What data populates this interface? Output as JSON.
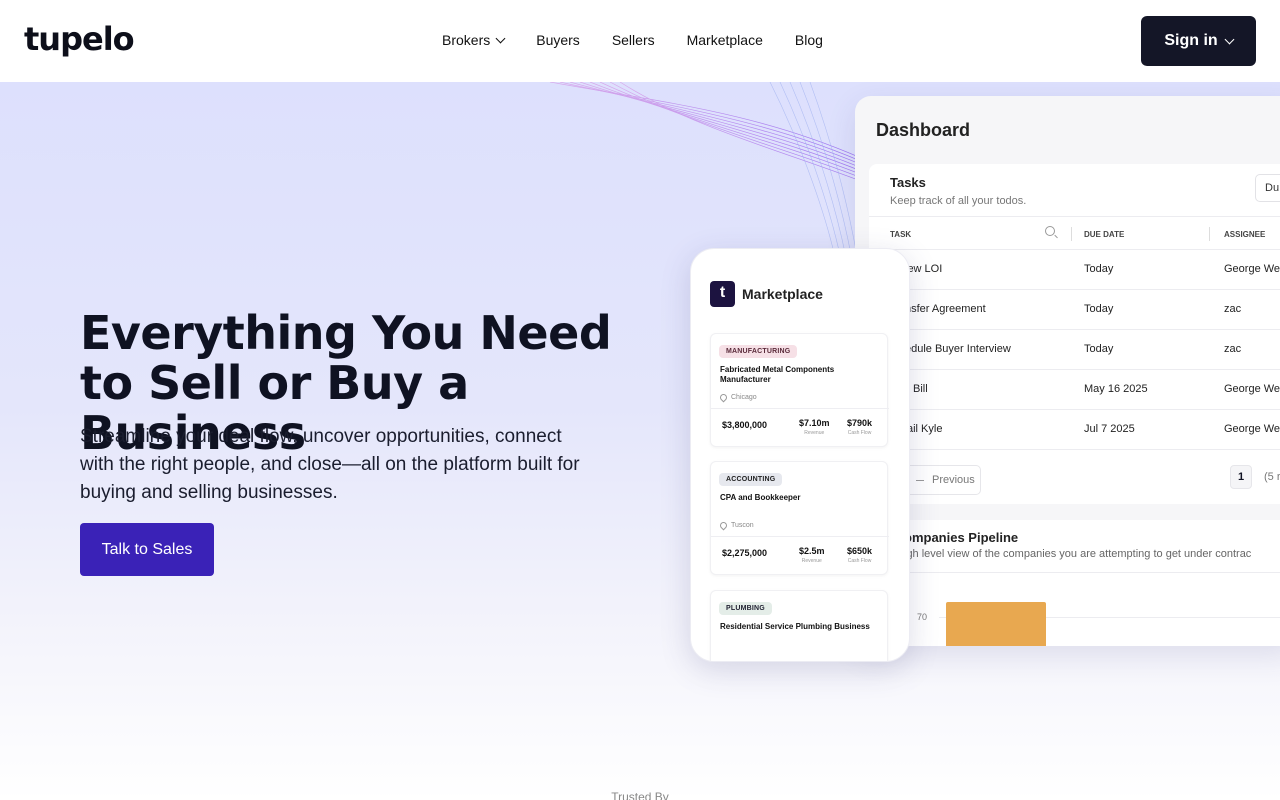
{
  "nav": {
    "logo": "tupelo",
    "links": [
      "Brokers",
      "Buyers",
      "Sellers",
      "Marketplace",
      "Blog"
    ],
    "signin": "Sign in"
  },
  "hero": {
    "headline": "Everything You Need to Sell or Buy a Business",
    "subline": "Streamline your deal flow, uncover opportunities, connect with the right people, and close—all on the platform built for buying and selling businesses.",
    "cta": "Talk to Sales"
  },
  "dashboard": {
    "title": "Dashboard",
    "tasks": {
      "title": "Tasks",
      "subtitle": "Keep track of all your todos.",
      "button": "Du",
      "columns": [
        "TASK",
        "DUE DATE",
        "ASSIGNEE"
      ],
      "rows": [
        {
          "task": "iew LOI",
          "due": "Today",
          "assignee": "George We"
        },
        {
          "task": "nsfer Agreement",
          "due": "Today",
          "assignee": "zac"
        },
        {
          "task": "edule Buyer Interview",
          "due": "Today",
          "assignee": "zac"
        },
        {
          "task": "Bill",
          "due": "May 16 2025",
          "assignee": "George We"
        },
        {
          "task": "ail Kyle",
          "due": "Jul 7 2025",
          "assignee": "George We"
        }
      ],
      "prev": "Previous",
      "page": "1",
      "page_extra": "(5 r"
    },
    "pipeline": {
      "title": "ompanies Pipeline",
      "subtitle": "igh level view of the companies you are attempting to get under contrac",
      "axis_tick": "70"
    }
  },
  "marketplace": {
    "logo_letter": "t",
    "title": "Marketplace",
    "listings": [
      {
        "tag": "MANUFACTURING",
        "tag_bg": "#f6e0e6",
        "name": "Fabricated Metal Components Manufacturer",
        "location": "Chicago",
        "price": "$3,800,000",
        "revenue": "$7.10m",
        "revenue_label": "Revenue",
        "cashflow": "$790k",
        "cashflow_label": "Cash Flow"
      },
      {
        "tag": "ACCOUNTING",
        "tag_bg": "#e6e8ee",
        "name": "CPA and Bookkeeper",
        "location": "Tuscon",
        "price": "$2,275,000",
        "revenue": "$2.5m",
        "revenue_label": "Revenue",
        "cashflow": "$650k",
        "cashflow_label": "Cash Flow"
      },
      {
        "tag": "PLUMBING",
        "tag_bg": "#e4ede8",
        "name": "Residential Service Plumbing Business"
      }
    ]
  },
  "trusted": "Trusted By",
  "colors": {
    "cta": "#3a22b7",
    "signin": "#141627",
    "bar": "#e8a850"
  }
}
